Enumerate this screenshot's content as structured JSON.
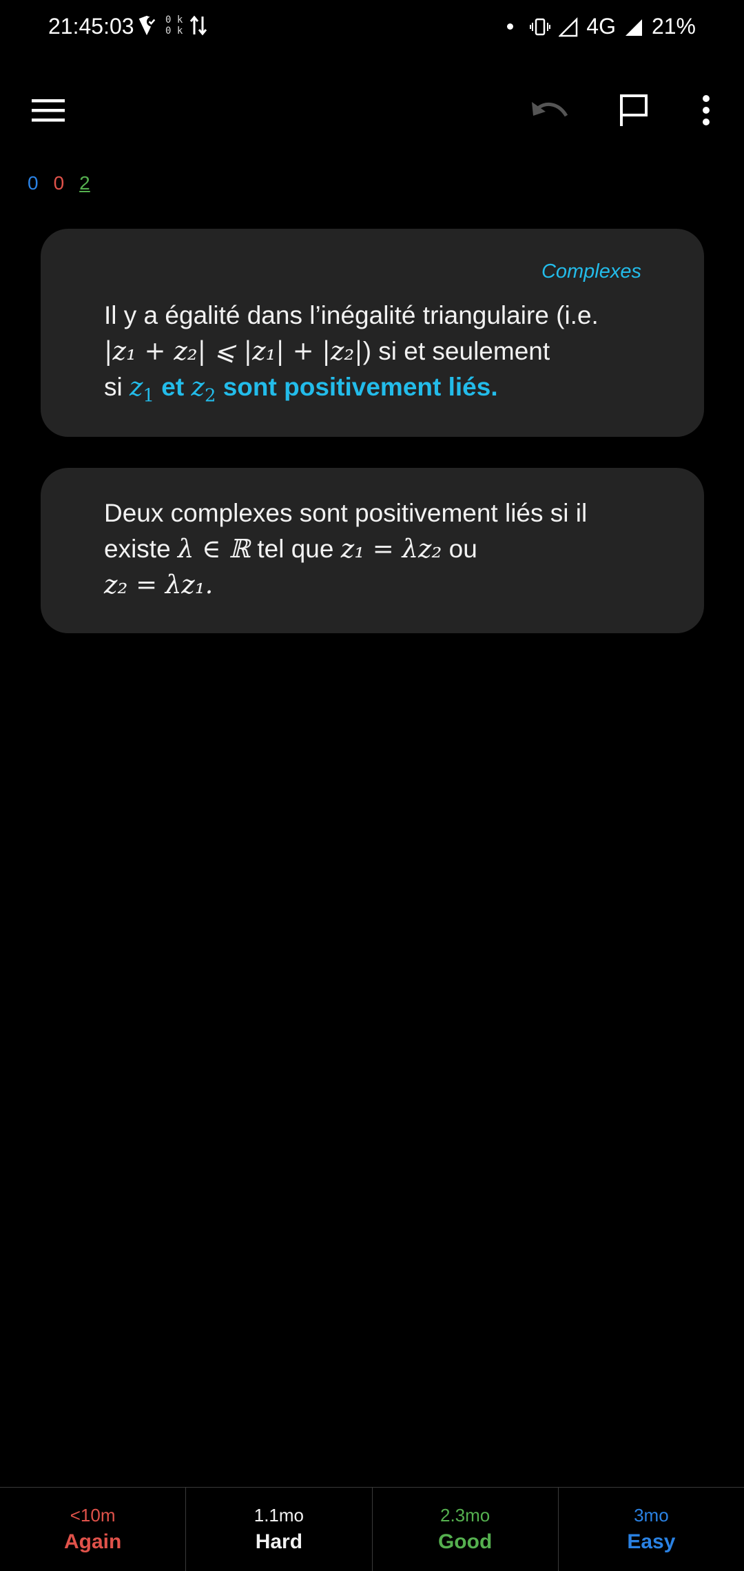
{
  "status_bar": {
    "time": "21:45:03",
    "net_speed_up": "0 k",
    "net_speed_down": "0 k",
    "network": "4G",
    "battery": "21%"
  },
  "toolbar": {
    "menu_icon": "hamburger-menu-icon",
    "undo_icon": "undo-icon",
    "flag_icon": "flag-icon",
    "more_icon": "more-vertical-icon"
  },
  "counts": {
    "new": "0",
    "learning": "0",
    "review": "2"
  },
  "card_front": {
    "deck": "Complexes",
    "line1": "Il y a égalité dans l’inégalité triangulaire (i.e.",
    "math_inequality": "|z₁ + z₂| ⩽ |z₁| + |z₂|",
    "line2_suffix": ") si et seulement",
    "line3_prefix": "si",
    "z1": "z",
    "z1_sub": "1",
    "cloze_et": "et",
    "z2": "z",
    "z2_sub": "2",
    "cloze_rest": "sont positivement liés."
  },
  "card_back": {
    "text1": "Deux complexes sont positivement liés si il",
    "text2_prefix": "existe",
    "math1": "λ ∈ ℝ",
    "text2_mid": "tel que",
    "math2": "z₁ = λz₂",
    "text2_suffix": "ou",
    "math3": "z₂ = λz₁."
  },
  "answers": {
    "again": {
      "interval": "<10m",
      "label": "Again"
    },
    "hard": {
      "interval": "1.1mo",
      "label": "Hard"
    },
    "good": {
      "interval": "2.3mo",
      "label": "Good"
    },
    "easy": {
      "interval": "3mo",
      "label": "Easy"
    }
  },
  "colors": {
    "accent": "#23bcea",
    "again": "#e0524a",
    "good": "#55b04f",
    "easy": "#2a82e4",
    "card_bg": "#242424"
  }
}
